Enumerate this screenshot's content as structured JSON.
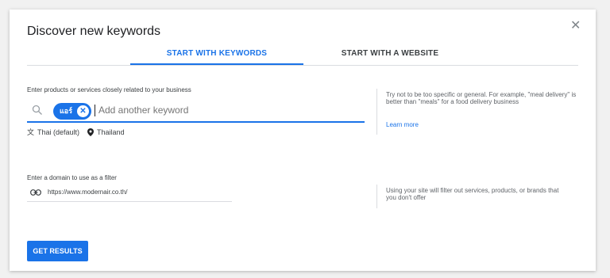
{
  "dialog": {
    "title": "Discover new keywords",
    "close_icon": "close-icon"
  },
  "tabs": [
    {
      "label": "START WITH KEYWORDS",
      "active": true
    },
    {
      "label": "START WITH A WEBSITE",
      "active": false
    }
  ],
  "keywords": {
    "label": "Enter products or services closely related to your business",
    "chips": [
      {
        "text": "แอร์"
      }
    ],
    "placeholder": "Add another keyword",
    "language": "Thai (default)",
    "location": "Thailand",
    "tip": "Try not to be too specific or general. For example, \"meal delivery\" is better than \"meals\" for a food delivery business",
    "learn_more": "Learn more"
  },
  "domain": {
    "label": "Enter a domain to use as a filter",
    "value": "https://www.modernair.co.th/",
    "tip": "Using your site will filter out services, products, or brands that you don't offer"
  },
  "actions": {
    "get_results": "GET RESULTS"
  },
  "colors": {
    "accent": "#1a73e8"
  }
}
